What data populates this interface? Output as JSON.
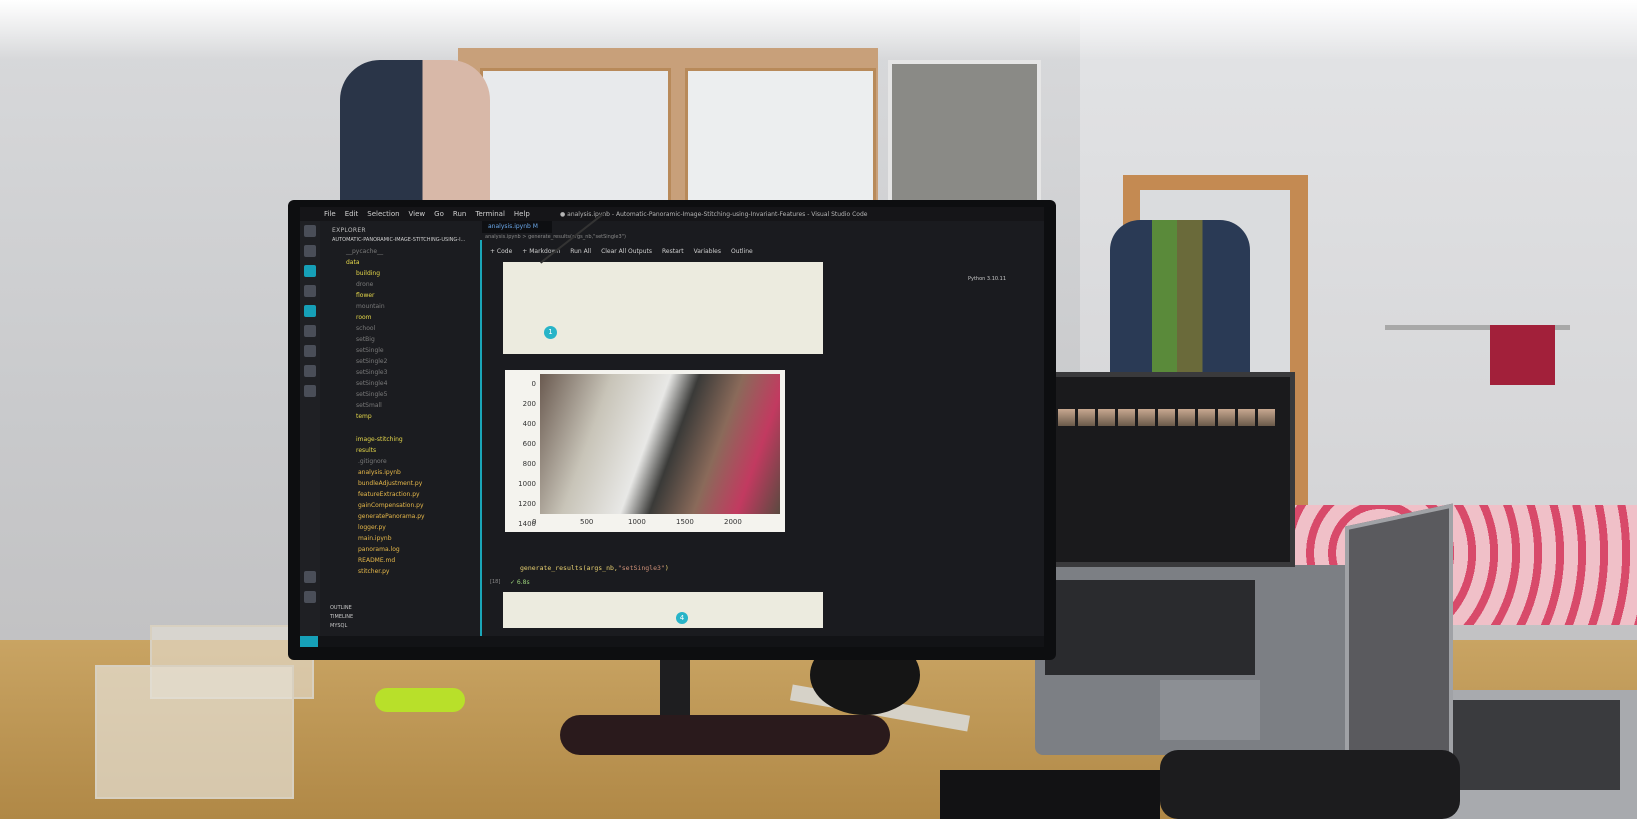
{
  "scene": {
    "description_tags": [
      "desk",
      "monitor",
      "laptop",
      "room",
      "panorama"
    ]
  },
  "vscode": {
    "menu": [
      "File",
      "Edit",
      "Selection",
      "View",
      "Go",
      "Run",
      "Terminal",
      "Help"
    ],
    "window_title": "● analysis.ipynb - Automatic-Panoramic-Image-Stitching-using-Invariant-Features - Visual Studio Code",
    "explorer_title": "EXPLORER",
    "project_name": "AUTOMATIC-PANORAMIC-IMAGE-STITCHING-USING-I...",
    "tree": [
      {
        "label": "__pycache__",
        "kind": "folder"
      },
      {
        "label": "data",
        "kind": "folder"
      },
      {
        "label": "building",
        "kind": "folder"
      },
      {
        "label": "drone",
        "kind": "muted"
      },
      {
        "label": "flower",
        "kind": "folder"
      },
      {
        "label": "mountain",
        "kind": "muted"
      },
      {
        "label": "room",
        "kind": "folder"
      },
      {
        "label": "school",
        "kind": "muted"
      },
      {
        "label": "setBig",
        "kind": "muted"
      },
      {
        "label": "setSingle",
        "kind": "muted"
      },
      {
        "label": "setSingle2",
        "kind": "muted"
      },
      {
        "label": "setSingle3",
        "kind": "muted"
      },
      {
        "label": "setSingle4",
        "kind": "muted"
      },
      {
        "label": "setSingle5",
        "kind": "muted"
      },
      {
        "label": "setSmall",
        "kind": "muted"
      },
      {
        "label": "temp",
        "kind": "folder"
      },
      {
        "label": "image-stitching",
        "kind": "folder"
      },
      {
        "label": "results",
        "kind": "folder"
      },
      {
        "label": ".gitignore",
        "kind": "muted"
      },
      {
        "label": "analysis.ipynb",
        "kind": "file"
      },
      {
        "label": "bundleAdjustment.py",
        "kind": "file"
      },
      {
        "label": "featureExtraction.py",
        "kind": "file"
      },
      {
        "label": "gainCompensation.py",
        "kind": "file"
      },
      {
        "label": "generatePanorama.py",
        "kind": "file"
      },
      {
        "label": "logger.py",
        "kind": "file"
      },
      {
        "label": "main.ipynb",
        "kind": "file"
      },
      {
        "label": "panorama.log",
        "kind": "file"
      },
      {
        "label": "README.md",
        "kind": "file"
      },
      {
        "label": "stitcher.py",
        "kind": "file"
      }
    ],
    "tab_label": "analysis.ipynb  M",
    "breadcrumb": "analysis.ipynb > generate_results(args_nb,\"setSingle3\")",
    "toolbar": [
      "+ Code",
      "+ Markdown",
      "Run All",
      "Clear All Outputs",
      "Restart",
      "Variables",
      "Outline"
    ],
    "kernel": "Python 3.10.11",
    "plot_yticks": [
      "0",
      "200",
      "400",
      "600",
      "800",
      "1000",
      "1200",
      "1400"
    ],
    "plot_xticks": [
      "0",
      "500",
      "1000",
      "1500",
      "2000"
    ],
    "code_prefix": "generate_results(args_nb,",
    "code_arg": "\"setSingle3\"",
    "code_suffix": ")",
    "exec_count": "[18]",
    "exec_time": "✓  6.8s",
    "marker_1": "1",
    "marker_4": "4",
    "outline": [
      "OUTLINE",
      "TIMELINE",
      "MYSQL"
    ],
    "colors": {
      "accent": "#1aa6b8",
      "folder": "#e6d84a"
    }
  }
}
